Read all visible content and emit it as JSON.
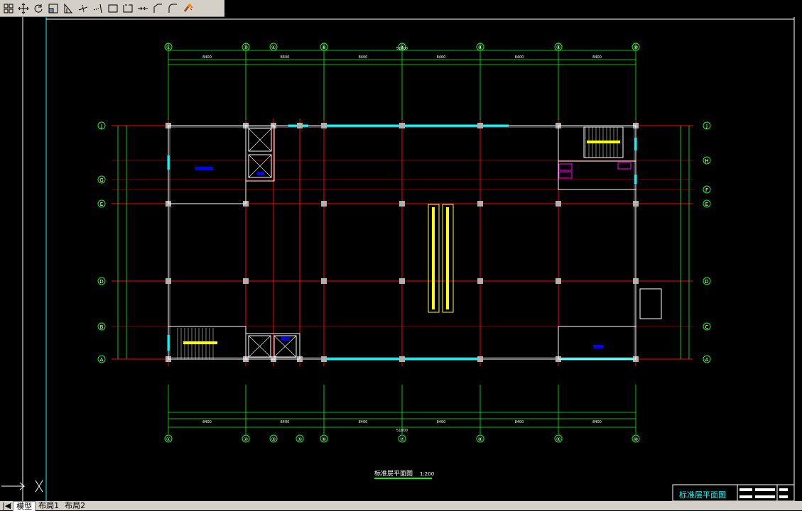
{
  "toolbar": {
    "icons": [
      "grid-icon",
      "select-window-icon",
      "pan-icon",
      "rotate-icon",
      "hatch-icon",
      "dimension-icon",
      "line-icon",
      "polyline-icon",
      "rectangle-icon",
      "open-rect-icon",
      "break-icon",
      "fillet-icon",
      "chamfer-icon",
      "paint-icon"
    ]
  },
  "colors": {
    "background": "#000000",
    "grid_line": "#ff0000",
    "dimension": "#00ff00",
    "wall": "#ffffff",
    "window": "#00ffff",
    "stair": "#ffff00",
    "room_label": "#0000ff",
    "axis_bubble": "#00ff00"
  },
  "drawing": {
    "axes_top": [
      "①",
      "②",
      "④",
      "⑥",
      "⑦",
      "⑧",
      "⑨",
      "⑩"
    ],
    "axes_bottom": [
      "①",
      "②",
      "③",
      "⑤",
      "⑥",
      "⑦",
      "⑧",
      "⑨",
      "⑩"
    ],
    "axes_left": [
      "J",
      "G",
      "E",
      "D",
      "B",
      "A"
    ],
    "axes_right": [
      "J",
      "H",
      "F",
      "E",
      "D",
      "C",
      "A"
    ],
    "overall_dim": "51000",
    "bay_dims_top": [
      "8400",
      "8400",
      "8400",
      "8400",
      "8400",
      "8400"
    ],
    "sub_dims_top": [
      "7800",
      "2700",
      "2400",
      "7800",
      "7800",
      "7800",
      "7800"
    ],
    "bay_dims_bottom": [
      "8400",
      "8400",
      "8400",
      "8400",
      "8400",
      "8400"
    ],
    "sub_dims_bottom": [
      "7800",
      "2550",
      "2550",
      "7800",
      "7800",
      "7800",
      "7800"
    ],
    "overall_dim_bottom": "51000",
    "left_dims": [
      "2400",
      "8400",
      "7800",
      "8400",
      "1680"
    ],
    "right_dims": [
      "1570",
      "3900",
      "2500",
      "7800",
      "4200",
      "6400"
    ],
    "title": "标准层平面图",
    "scale": "1:200"
  },
  "title_block": {
    "title": "标准层平面图"
  },
  "tabs": {
    "model": "模型",
    "layout1": "布局1",
    "layout2": "布局2"
  }
}
